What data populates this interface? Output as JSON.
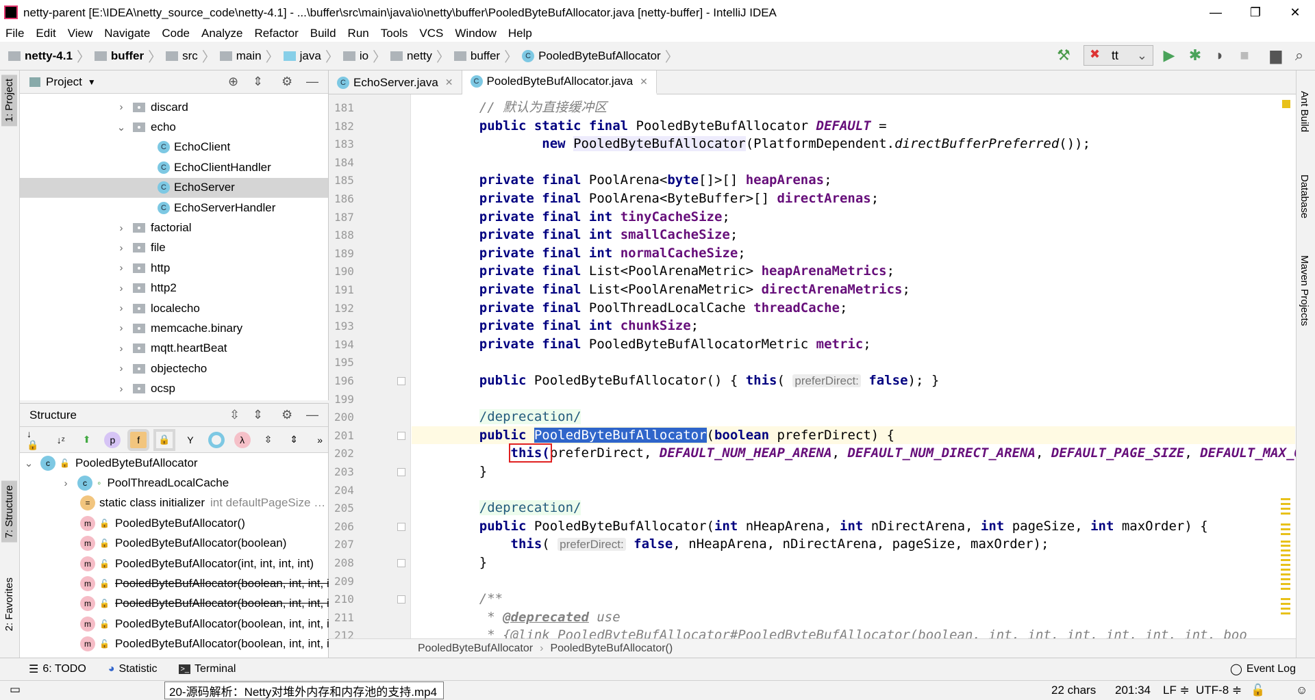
{
  "window": {
    "title": "netty-parent [E:\\IDEA\\netty_source_code\\netty-4.1] - ...\\buffer\\src\\main\\java\\io\\netty\\buffer\\PooledByteBufAllocator.java [netty-buffer] - IntelliJ IDEA",
    "minimize": "—",
    "maximize": "❐",
    "close": "✕"
  },
  "menu": [
    "File",
    "Edit",
    "View",
    "Navigate",
    "Code",
    "Analyze",
    "Refactor",
    "Build",
    "Run",
    "Tools",
    "VCS",
    "Window",
    "Help"
  ],
  "breadcrumb": [
    {
      "label": "netty-4.1",
      "bold": true
    },
    {
      "label": "buffer",
      "bold": true
    },
    {
      "label": "src"
    },
    {
      "label": "main"
    },
    {
      "label": "java"
    },
    {
      "label": "io"
    },
    {
      "label": "netty"
    },
    {
      "label": "buffer"
    },
    {
      "label": "PooledByteBufAllocator"
    }
  ],
  "toolbar": {
    "run_config": "tt"
  },
  "left_stripe": [
    "1: Project",
    "7: Structure",
    "2: Favorites"
  ],
  "right_stripe": [
    "Ant Build",
    "Database",
    "Maven Projects"
  ],
  "project": {
    "title": "Project",
    "items": [
      {
        "label": "discard",
        "type": "folder",
        "level": 0,
        "expanded": false
      },
      {
        "label": "echo",
        "type": "folder",
        "level": 0,
        "expanded": true
      },
      {
        "label": "EchoClient",
        "type": "class",
        "level": 1
      },
      {
        "label": "EchoClientHandler",
        "type": "class",
        "level": 1
      },
      {
        "label": "EchoServer",
        "type": "class",
        "level": 1,
        "selected": true
      },
      {
        "label": "EchoServerHandler",
        "type": "class",
        "level": 1
      },
      {
        "label": "factorial",
        "type": "folder",
        "level": 0
      },
      {
        "label": "file",
        "type": "folder",
        "level": 0
      },
      {
        "label": "http",
        "type": "folder",
        "level": 0
      },
      {
        "label": "http2",
        "type": "folder",
        "level": 0
      },
      {
        "label": "localecho",
        "type": "folder",
        "level": 0
      },
      {
        "label": "memcache.binary",
        "type": "folder",
        "level": 0
      },
      {
        "label": "mqtt.heartBeat",
        "type": "folder",
        "level": 0
      },
      {
        "label": "objectecho",
        "type": "folder",
        "level": 0
      },
      {
        "label": "ocsp",
        "type": "folder",
        "level": 0
      }
    ]
  },
  "structure": {
    "title": "Structure",
    "items": [
      {
        "label": "PooledByteBufAllocator",
        "badge": "c",
        "level": 0,
        "chev": "⌄"
      },
      {
        "label": "PoolThreadLocalCache",
        "badge": "c",
        "level": 1,
        "chev": "›"
      },
      {
        "label": "static class initializer",
        "hint": "int defaultPageSize …",
        "badge": "=",
        "level": 1
      },
      {
        "label": "PooledByteBufAllocator()",
        "badge": "m",
        "level": 1
      },
      {
        "label": "PooledByteBufAllocator(boolean)",
        "badge": "m",
        "level": 1
      },
      {
        "label": "PooledByteBufAllocator(int, int, int, int)",
        "badge": "m",
        "level": 1
      },
      {
        "label": "PooledByteBufAllocator(boolean, int, int, int, int)",
        "badge": "m",
        "level": 1,
        "deprecated": true
      },
      {
        "label": "PooledByteBufAllocator(boolean, int, int, int, int, int, int)",
        "badge": "m",
        "level": 1,
        "deprecated": true
      },
      {
        "label": "PooledByteBufAllocator(boolean, int, int, int, int, int, int, int)",
        "badge": "m",
        "level": 1
      },
      {
        "label": "PooledByteBufAllocator(boolean, int, int, int, int, int, int, int, int)",
        "badge": "m",
        "level": 1
      }
    ]
  },
  "tabs": [
    {
      "label": "EchoServer.java",
      "active": false
    },
    {
      "label": "PooledByteBufAllocator.java",
      "active": true
    }
  ],
  "code": [
    {
      "n": "181",
      "s": [
        [
          "    ",
          ""
        ],
        [
          "// 默认为直接缓冲区",
          "cmt"
        ]
      ]
    },
    {
      "n": "182",
      "s": [
        [
          "    ",
          ""
        ],
        [
          "public static final",
          "kw"
        ],
        [
          " PooledByteBufAllocator ",
          ""
        ],
        [
          "DEFAULT",
          "ifld"
        ],
        [
          " =",
          ""
        ]
      ]
    },
    {
      "n": "183",
      "s": [
        [
          "            ",
          ""
        ],
        [
          "new",
          "kw"
        ],
        [
          " ",
          ""
        ],
        [
          "PooledByteBufAllocator",
          "usage"
        ],
        [
          "(PlatformDependent.",
          ""
        ],
        [
          "directBufferPreferred",
          "st"
        ],
        [
          "());",
          ""
        ]
      ]
    },
    {
      "n": "184",
      "s": []
    },
    {
      "n": "185",
      "s": [
        [
          "    ",
          ""
        ],
        [
          "private final",
          "kw"
        ],
        [
          " PoolArena<",
          ""
        ],
        [
          "byte",
          "kw"
        ],
        [
          "[]>[] ",
          ""
        ],
        [
          "heapArenas",
          "fld"
        ],
        [
          ";",
          ""
        ]
      ]
    },
    {
      "n": "186",
      "s": [
        [
          "    ",
          ""
        ],
        [
          "private final",
          "kw"
        ],
        [
          " PoolArena<ByteBuffer>[] ",
          ""
        ],
        [
          "directArenas",
          "fld"
        ],
        [
          ";",
          ""
        ]
      ]
    },
    {
      "n": "187",
      "s": [
        [
          "    ",
          ""
        ],
        [
          "private final int",
          "kw"
        ],
        [
          " ",
          ""
        ],
        [
          "tinyCacheSize",
          "fld"
        ],
        [
          ";",
          ""
        ]
      ]
    },
    {
      "n": "188",
      "s": [
        [
          "    ",
          ""
        ],
        [
          "private final int",
          "kw"
        ],
        [
          " ",
          ""
        ],
        [
          "smallCacheSize",
          "fld"
        ],
        [
          ";",
          ""
        ]
      ]
    },
    {
      "n": "189",
      "s": [
        [
          "    ",
          ""
        ],
        [
          "private final int",
          "kw"
        ],
        [
          " ",
          ""
        ],
        [
          "normalCacheSize",
          "fld"
        ],
        [
          ";",
          ""
        ]
      ]
    },
    {
      "n": "190",
      "s": [
        [
          "    ",
          ""
        ],
        [
          "private final",
          "kw"
        ],
        [
          " List<PoolArenaMetric> ",
          ""
        ],
        [
          "heapArenaMetrics",
          "fld"
        ],
        [
          ";",
          ""
        ]
      ]
    },
    {
      "n": "191",
      "s": [
        [
          "    ",
          ""
        ],
        [
          "private final",
          "kw"
        ],
        [
          " List<PoolArenaMetric> ",
          ""
        ],
        [
          "directArenaMetrics",
          "fld"
        ],
        [
          ";",
          ""
        ]
      ]
    },
    {
      "n": "192",
      "s": [
        [
          "    ",
          ""
        ],
        [
          "private final",
          "kw"
        ],
        [
          " PoolThreadLocalCache ",
          ""
        ],
        [
          "threadCache",
          "fld"
        ],
        [
          ";",
          ""
        ]
      ]
    },
    {
      "n": "193",
      "s": [
        [
          "    ",
          ""
        ],
        [
          "private final int",
          "kw"
        ],
        [
          " ",
          ""
        ],
        [
          "chunkSize",
          "fld"
        ],
        [
          ";",
          ""
        ]
      ]
    },
    {
      "n": "194",
      "s": [
        [
          "    ",
          ""
        ],
        [
          "private final",
          "kw"
        ],
        [
          " PooledByteBufAllocatorMetric ",
          ""
        ],
        [
          "metric",
          "fld"
        ],
        [
          ";",
          ""
        ]
      ]
    },
    {
      "n": "195",
      "s": []
    },
    {
      "n": "196",
      "s": [
        [
          "    ",
          ""
        ],
        [
          "public",
          "kw"
        ],
        [
          " PooledByteBufAllocator() { ",
          ""
        ],
        [
          "this",
          "kw"
        ],
        [
          "( ",
          ""
        ],
        [
          "preferDirect:",
          "hint"
        ],
        [
          " ",
          ""
        ],
        [
          "false",
          "kw"
        ],
        [
          "); }",
          ""
        ]
      ]
    },
    {
      "n": "199",
      "s": []
    },
    {
      "n": "200",
      "s": [
        [
          "    ",
          ""
        ],
        [
          "/deprecation/",
          "ann"
        ]
      ]
    },
    {
      "n": "201",
      "current": true,
      "s": [
        [
          "    ",
          ""
        ],
        [
          "public",
          "kw"
        ],
        [
          " ",
          ""
        ],
        [
          "PooledByteBufAllocator",
          "selw"
        ],
        [
          "(",
          ""
        ],
        [
          "boolean",
          "kw"
        ],
        [
          " preferDirect) {",
          ""
        ]
      ]
    },
    {
      "n": "202",
      "s": [
        [
          "        ",
          ""
        ],
        [
          "this(",
          "kw redbox"
        ],
        [
          "preferDirect, ",
          ""
        ],
        [
          "DEFAULT_NUM_HEAP_ARENA",
          "ifld"
        ],
        [
          ", ",
          ""
        ],
        [
          "DEFAULT_NUM_DIRECT_ARENA",
          "ifld"
        ],
        [
          ", ",
          ""
        ],
        [
          "DEFAULT_PAGE_SIZE",
          "ifld"
        ],
        [
          ", ",
          ""
        ],
        [
          "DEFAULT_MAX_ORDER",
          "ifld"
        ]
      ]
    },
    {
      "n": "203",
      "s": [
        [
          "    }",
          ""
        ]
      ]
    },
    {
      "n": "204",
      "s": []
    },
    {
      "n": "205",
      "s": [
        [
          "    ",
          ""
        ],
        [
          "/deprecation/",
          "ann"
        ]
      ]
    },
    {
      "n": "206",
      "s": [
        [
          "    ",
          ""
        ],
        [
          "public",
          "kw"
        ],
        [
          " PooledByteBufAllocator(",
          ""
        ],
        [
          "int",
          "kw"
        ],
        [
          " nHeapArena, ",
          ""
        ],
        [
          "int",
          "kw"
        ],
        [
          " nDirectArena, ",
          ""
        ],
        [
          "int",
          "kw"
        ],
        [
          " pageSize, ",
          ""
        ],
        [
          "int",
          "kw"
        ],
        [
          " maxOrder) {",
          ""
        ]
      ]
    },
    {
      "n": "207",
      "s": [
        [
          "        ",
          ""
        ],
        [
          "this",
          "kw"
        ],
        [
          "( ",
          ""
        ],
        [
          "preferDirect:",
          "hint"
        ],
        [
          " ",
          ""
        ],
        [
          "false",
          "kw"
        ],
        [
          ", nHeapArena, nDirectArena, pageSize, maxOrder);",
          ""
        ]
      ]
    },
    {
      "n": "208",
      "s": [
        [
          "    }",
          ""
        ]
      ]
    },
    {
      "n": "209",
      "s": []
    },
    {
      "n": "210",
      "s": [
        [
          "    ",
          ""
        ],
        [
          "/**",
          "cmt"
        ]
      ]
    },
    {
      "n": "211",
      "s": [
        [
          "     * ",
          "cmt"
        ],
        [
          "@deprecated",
          "tag"
        ],
        [
          " use",
          "cmt"
        ]
      ]
    },
    {
      "n": "212",
      "s": [
        [
          "     * {@link ",
          "cmt"
        ],
        [
          "PooledByteBufAllocator#PooledByteBufAllocator",
          "cmt"
        ],
        [
          "(boolean, int, int, int, int, int, int, boo",
          "cmt"
        ]
      ]
    }
  ],
  "editor_breadcrumb": [
    "PooledByteBufAllocator",
    "PooledByteBufAllocator()"
  ],
  "bottom_tools": [
    "6: TODO",
    "Statistic",
    "Terminal"
  ],
  "event_log": "Event Log",
  "status": {
    "tooltip": "20-源码解析：Netty对堆外内存和内存池的支持.mp4",
    "chars": "22 chars",
    "position": "201:34",
    "line_sep": "LF ≑",
    "encoding": "UTF-8 ≑"
  }
}
